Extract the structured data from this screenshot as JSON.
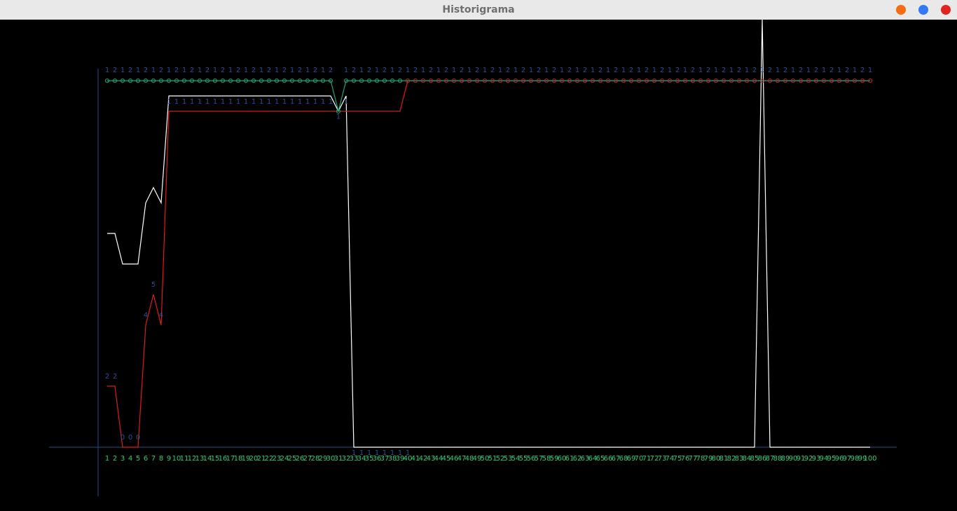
{
  "window": {
    "title": "Historigrama",
    "buttons": [
      {
        "name": "minimize",
        "color": "#f46d16"
      },
      {
        "name": "maximize",
        "color": "#3478f6"
      },
      {
        "name": "close",
        "color": "#e02424"
      }
    ]
  },
  "chart_data": {
    "type": "line",
    "title": "",
    "xlabel": "",
    "ylabel": "",
    "x": [
      1,
      2,
      3,
      4,
      5,
      6,
      7,
      8,
      9,
      10,
      11,
      12,
      13,
      14,
      15,
      16,
      17,
      18,
      19,
      20,
      21,
      22,
      23,
      24,
      25,
      26,
      27,
      28,
      29,
      30,
      31,
      32,
      33,
      34,
      35,
      36,
      37,
      38,
      39,
      40,
      41,
      42,
      43,
      44,
      45,
      46,
      47,
      48,
      49,
      50,
      51,
      52,
      53,
      54,
      55,
      56,
      57,
      58,
      59,
      60,
      61,
      62,
      63,
      64,
      65,
      66,
      67,
      68,
      69,
      70,
      71,
      72,
      73,
      74,
      75,
      76,
      77,
      78,
      79,
      80,
      81,
      82,
      83,
      84,
      85,
      86,
      87,
      88,
      89,
      90,
      91,
      92,
      93,
      94,
      95,
      96,
      97,
      98,
      99,
      100
    ],
    "ylim": [
      0,
      14
    ],
    "grid": false,
    "colors": {
      "axis": "#1d4f8a",
      "x_tick_labels": "#2ecc71",
      "value_labels": "#2a4f96",
      "red_series": "#e01b1b",
      "green_series": "#1ea37a",
      "white_series": "#ffffff",
      "markers_green": "#1ea37a",
      "markers_red": "#c0282d"
    },
    "series": [
      {
        "color": "#e01b1b",
        "values": [
          2,
          2,
          0,
          0,
          0,
          4,
          5,
          4,
          11,
          11,
          11,
          11,
          11,
          11,
          11,
          11,
          11,
          11,
          11,
          11,
          11,
          11,
          11,
          11,
          11,
          11,
          11,
          11,
          11,
          11,
          11,
          11,
          11,
          11,
          11,
          11,
          11,
          11,
          11,
          12,
          12,
          12,
          12,
          12,
          12,
          12,
          12,
          12,
          12,
          12,
          12,
          12,
          12,
          12,
          12,
          12,
          12,
          12,
          12,
          12,
          12,
          12,
          12,
          12,
          12,
          12,
          12,
          12,
          12,
          12,
          12,
          12,
          12,
          12,
          12,
          12,
          12,
          12,
          12,
          12,
          12,
          12,
          12,
          12,
          12,
          12,
          12,
          12,
          12,
          12,
          12,
          12,
          12,
          12,
          12,
          12,
          12,
          12,
          12,
          12
        ],
        "point_labels": [
          "2",
          "2",
          "0",
          "0",
          "0",
          "4",
          "5",
          "4",
          "1",
          "1",
          "1",
          "1",
          "1",
          "1",
          "1",
          "1",
          "1",
          "1",
          "1",
          "1",
          "1",
          "1",
          "1",
          "1",
          "1",
          "1",
          "1",
          "1",
          "1",
          "1",
          "1",
          "1",
          "1",
          "1",
          "1",
          "1",
          "1",
          "1",
          "1",
          "1",
          "2",
          "1",
          "2",
          "1",
          "2",
          "1",
          "2",
          "1",
          "2",
          "1",
          "2",
          "1",
          "2",
          "1",
          "2",
          "1",
          "2",
          "1",
          "2",
          "1",
          "2",
          "1",
          "2",
          "1",
          "2",
          "1",
          "2",
          "1",
          "2",
          "1",
          "2",
          "1",
          "2",
          "1",
          "2",
          "1",
          "2",
          "1",
          "2",
          "1",
          "2",
          "1",
          "2",
          "1",
          "2",
          "1",
          "2",
          "1",
          "2",
          "1",
          "2",
          "1",
          "2",
          "1",
          "2",
          "1",
          "2",
          "1",
          "2",
          "1"
        ]
      },
      {
        "color": "#1ea37a",
        "values": [
          12,
          12,
          12,
          12,
          12,
          12,
          12,
          12,
          12,
          12,
          12,
          12,
          12,
          12,
          12,
          12,
          12,
          12,
          12,
          12,
          12,
          12,
          12,
          12,
          12,
          12,
          12,
          12,
          12,
          12,
          11,
          12,
          12,
          12,
          12,
          12,
          12,
          12,
          12,
          12,
          12,
          12,
          12,
          12,
          12,
          12,
          12,
          12,
          12,
          12,
          12,
          12,
          12,
          12,
          12,
          12,
          12,
          12,
          12,
          12,
          12,
          12,
          12,
          12,
          12,
          12,
          12,
          12,
          12,
          12,
          12,
          12,
          12,
          12,
          12,
          12,
          12,
          12,
          12,
          12,
          12,
          12,
          12,
          12,
          12,
          12,
          12,
          12,
          12,
          12,
          12,
          12,
          12,
          12,
          12,
          12,
          12,
          12,
          12,
          12
        ],
        "top_labels": [
          "1",
          "2",
          "1",
          "2",
          "1",
          "2",
          "1",
          "2",
          "1",
          "2",
          "1",
          "2",
          "1",
          "2",
          "1",
          "2",
          "1",
          "2",
          "1",
          "2",
          "1",
          "2",
          "1",
          "2",
          "1",
          "2",
          "1",
          "2",
          "1",
          "2",
          "",
          "1",
          "2",
          "1",
          "2",
          "1",
          "2",
          "1",
          "2",
          "1",
          "2",
          "1",
          "2",
          "1",
          "2",
          "1",
          "2",
          "1",
          "2",
          "1",
          "2",
          "1",
          "2",
          "1",
          "2",
          "1",
          "2",
          "1",
          "2",
          "1",
          "2",
          "1",
          "2",
          "1",
          "2",
          "1",
          "2",
          "1",
          "2",
          "1",
          "2",
          "1",
          "2",
          "1",
          "2",
          "1",
          "2",
          "1",
          "2",
          "1",
          "2",
          "1",
          "2",
          "1",
          "2",
          "1",
          "2",
          "1",
          "2",
          "1",
          "2",
          "1",
          "2",
          "1",
          "2",
          "1",
          "2",
          "1",
          "2",
          "1"
        ]
      },
      {
        "color": "#ffffff",
        "values": [
          7,
          7,
          6,
          6,
          6,
          8,
          8.5,
          8,
          11.5,
          11.5,
          11.5,
          11.5,
          11.5,
          11.5,
          11.5,
          11.5,
          11.5,
          11.5,
          11.5,
          11.5,
          11.5,
          11.5,
          11.5,
          11.5,
          11.5,
          11.5,
          11.5,
          11.5,
          11.5,
          11.5,
          11,
          11.5,
          0,
          0,
          0,
          0,
          0,
          0,
          0,
          0,
          0,
          0,
          0,
          0,
          0,
          0,
          0,
          0,
          0,
          0,
          0,
          0,
          0,
          0,
          0,
          0,
          0,
          0,
          0,
          0,
          0,
          0,
          0,
          0,
          0,
          0,
          0,
          0,
          0,
          0,
          0,
          0,
          0,
          0,
          0,
          0,
          0,
          0,
          0,
          0,
          0,
          0,
          0,
          0,
          0,
          14,
          0,
          0,
          0,
          0,
          0,
          0,
          0,
          0,
          0,
          0,
          0,
          0,
          0,
          0
        ]
      }
    ]
  }
}
